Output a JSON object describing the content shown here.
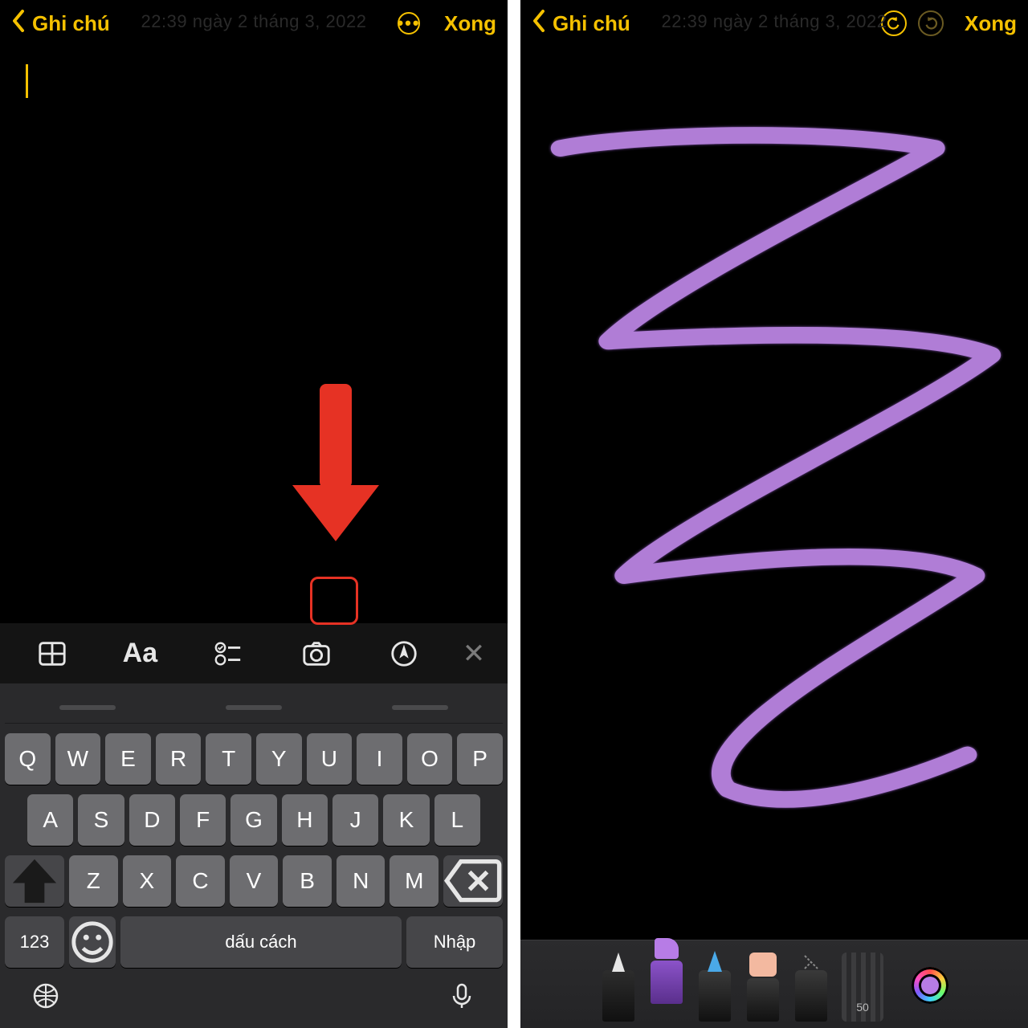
{
  "colors": {
    "accent": "#f5c100",
    "arrow": "#e63224",
    "stroke": "#b07dd6"
  },
  "left": {
    "back_label": "Ghi chú",
    "done_label": "Xong",
    "ghost_timestamp": "22:39 ngày 2 tháng 3, 2022",
    "fmt": {
      "aa": "Aa",
      "close": "✕"
    },
    "keyboard": {
      "row1": [
        "Q",
        "W",
        "E",
        "R",
        "T",
        "Y",
        "U",
        "I",
        "O",
        "P"
      ],
      "row2": [
        "A",
        "S",
        "D",
        "F",
        "G",
        "H",
        "J",
        "K",
        "L"
      ],
      "row3": [
        "Z",
        "X",
        "C",
        "V",
        "B",
        "N",
        "M"
      ],
      "num": "123",
      "space": "dấu cách",
      "enter": "Nhập"
    }
  },
  "right": {
    "back_label": "Ghi chú",
    "done_label": "Xong",
    "ghost_timestamp": "22:39 ngày 2 tháng 3, 2022",
    "ruler_label": "50"
  }
}
